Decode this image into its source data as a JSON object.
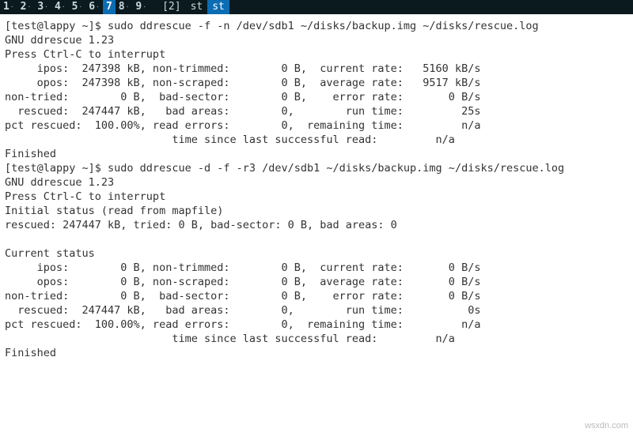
{
  "tabs": {
    "workspaces": [
      "1",
      "2",
      "3",
      "4",
      "5",
      "6",
      "7",
      "8",
      "9"
    ],
    "active_workspace": "7",
    "session_count": "[2]",
    "labels": [
      "st",
      "st"
    ],
    "active_label_index": 1
  },
  "prompt1": {
    "full": "[test@lappy ~]$ sudo ddrescue -f -n /dev/sdb1 ~/disks/backup.img ~/disks/rescue.log"
  },
  "run1": {
    "version": "GNU ddrescue 1.23",
    "interrupt": "Press Ctrl-C to interrupt",
    "l1": "     ipos:  247398 kB, non-trimmed:        0 B,  current rate:   5160 kB/s",
    "l2": "     opos:  247398 kB, non-scraped:        0 B,  average rate:   9517 kB/s",
    "l3": "non-tried:        0 B,  bad-sector:        0 B,    error rate:       0 B/s",
    "l4": "  rescued:  247447 kB,   bad areas:        0,        run time:         25s",
    "l5": "pct rescued:  100.00%, read errors:        0,  remaining time:         n/a",
    "l6": "                          time since last successful read:         n/a",
    "finished": "Finished"
  },
  "prompt2": {
    "full": "[test@lappy ~]$ sudo ddrescue -d -f -r3 /dev/sdb1 ~/disks/backup.img ~/disks/rescue.log"
  },
  "run2": {
    "version": "GNU ddrescue 1.23",
    "interrupt": "Press Ctrl-C to interrupt",
    "initial_header": "Initial status (read from mapfile)",
    "initial_line": "rescued: 247447 kB, tried: 0 B, bad-sector: 0 B, bad areas: 0",
    "current_header": "Current status",
    "l1": "     ipos:        0 B, non-trimmed:        0 B,  current rate:       0 B/s",
    "l2": "     opos:        0 B, non-scraped:        0 B,  average rate:       0 B/s",
    "l3": "non-tried:        0 B,  bad-sector:        0 B,    error rate:       0 B/s",
    "l4": "  rescued:  247447 kB,   bad areas:        0,        run time:          0s",
    "l5": "pct rescued:  100.00%, read errors:        0,  remaining time:         n/a",
    "l6": "                          time since last successful read:         n/a",
    "finished": "Finished"
  },
  "watermark": "wsxdn.com"
}
